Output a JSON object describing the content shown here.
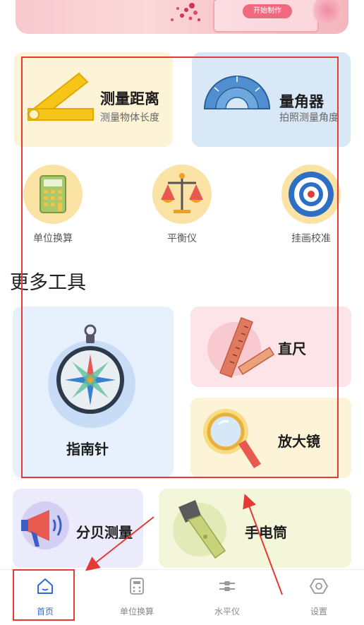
{
  "banner": {
    "button_label": "开始制作"
  },
  "tools": {
    "distance": {
      "title": "测量距离",
      "subtitle": "测量物体长度"
    },
    "angle": {
      "title": "量角器",
      "subtitle": "拍照测量角度"
    },
    "unit": {
      "label": "单位换算"
    },
    "balance": {
      "label": "平衡仪"
    },
    "hang": {
      "label": "挂画校准"
    }
  },
  "more_tools": {
    "title": "更多工具",
    "compass": "指南针",
    "ruler": "直尺",
    "magnifier": "放大镜",
    "decibel": "分贝测量",
    "flashlight": "手电筒"
  },
  "nav": {
    "items": [
      {
        "label": "首页",
        "icon": "home-icon",
        "active": true
      },
      {
        "label": "单位换算",
        "icon": "calculator-icon",
        "active": false
      },
      {
        "label": "水平仪",
        "icon": "level-icon",
        "active": false
      },
      {
        "label": "设置",
        "icon": "settings-icon",
        "active": false
      }
    ]
  },
  "colors": {
    "accent": "#2f6bd6",
    "annotation": "#e53935"
  }
}
